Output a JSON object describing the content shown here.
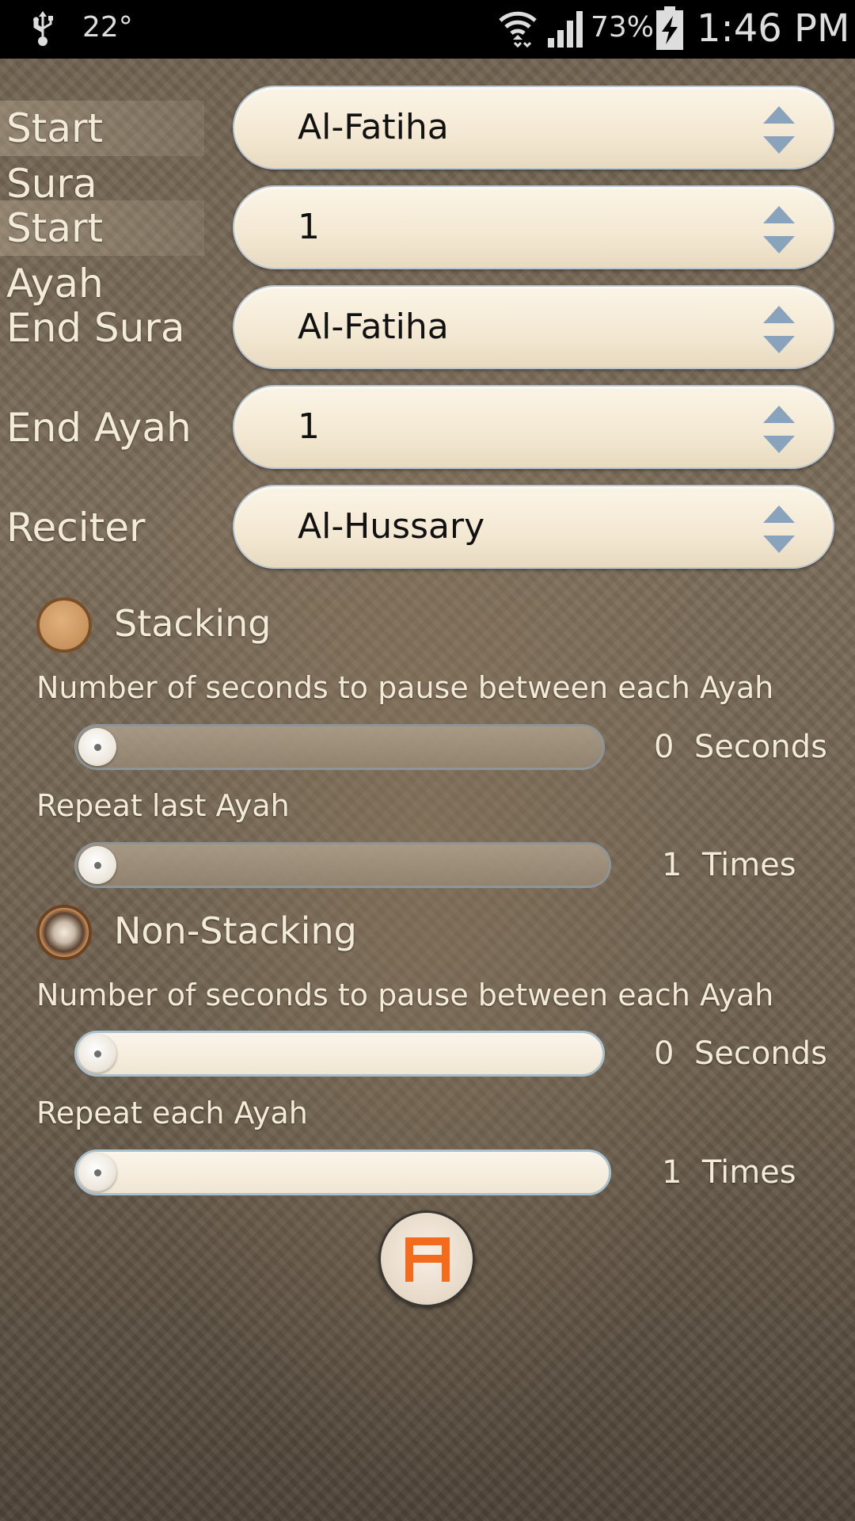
{
  "status_bar": {
    "temperature": "22°",
    "battery_percent": "73%",
    "time": "1:46 PM",
    "icons": [
      "usb-icon",
      "wifi-icon",
      "signal-icon",
      "battery-charging-icon"
    ]
  },
  "form": {
    "start_sura": {
      "label": "Start Sura",
      "value": "Al-Fatiha"
    },
    "start_ayah": {
      "label": "Start Ayah",
      "value": "1"
    },
    "end_sura": {
      "label": "End Sura",
      "value": "Al-Fatiha"
    },
    "end_ayah": {
      "label": "End Ayah",
      "value": "1"
    },
    "reciter": {
      "label": "Reciter",
      "value": "Al-Hussary"
    }
  },
  "stacking": {
    "label": "Stacking",
    "selected": false,
    "pause_caption": "Number of seconds to pause between each Ayah",
    "pause_value": "0  Seconds",
    "repeat_caption": "Repeat last Ayah",
    "repeat_value": "1  Times"
  },
  "non_stacking": {
    "label": "Non-Stacking",
    "selected": true,
    "pause_caption": "Number of seconds to pause between each Ayah",
    "pause_value": "0  Seconds",
    "repeat_caption": "Repeat each Ayah",
    "repeat_value": "1  Times"
  },
  "save_button": {
    "icon": "save-icon"
  },
  "colors": {
    "accent": "#f36b1c",
    "label_text": "#f3ead8",
    "spinner_bg": "#f7eedc"
  }
}
